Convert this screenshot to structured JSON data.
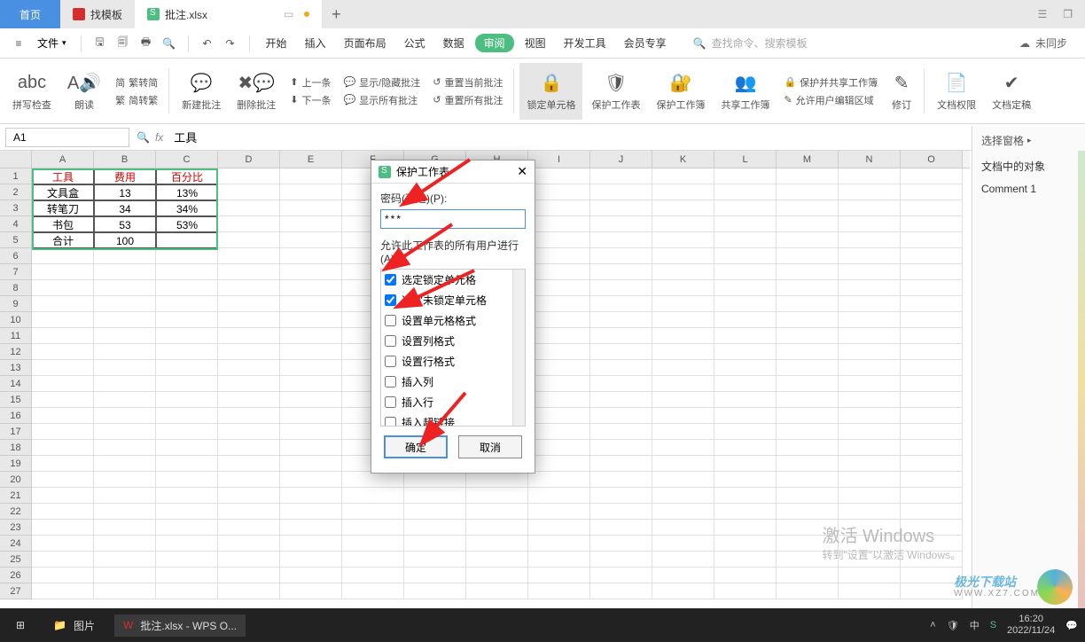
{
  "tabs": {
    "home": "首页",
    "template": "找模板",
    "file": "批注.xlsx",
    "add": "+"
  },
  "menubar": {
    "file": "文件",
    "items": [
      "开始",
      "插入",
      "页面布局",
      "公式",
      "数据",
      "审阅",
      "视图",
      "开发工具",
      "会员专享"
    ],
    "search_placeholder": "查找命令、搜索模板",
    "sync": "未同步"
  },
  "ribbon": {
    "spellcheck": "拼写检查",
    "read": "朗读",
    "convert1": "繁转简",
    "convert2": "简转繁",
    "newcomment": "新建批注",
    "delcomment": "删除批注",
    "prev": "上一条",
    "next": "下一条",
    "showhide": "显示/隐藏批注",
    "showall": "显示所有批注",
    "resetcur": "重置当前批注",
    "resetall": "重置所有批注",
    "lockcell": "锁定单元格",
    "protectsheet": "保护工作表",
    "protectbook": "保护工作簿",
    "sharebook": "共享工作簿",
    "protectshare": "保护并共享工作簿",
    "alloweditarea": "允许用户编辑区域",
    "revise": "修订",
    "docperm": "文档权限",
    "docfinal": "文档定稿"
  },
  "formulabar": {
    "name": "A1",
    "fx": "fx",
    "value": "工具"
  },
  "columns": [
    "A",
    "B",
    "C",
    "D",
    "E",
    "F",
    "G",
    "H",
    "I",
    "J",
    "K",
    "L",
    "M",
    "N",
    "O"
  ],
  "table": {
    "hdr": [
      "工具",
      "费用",
      "百分比"
    ],
    "rows": [
      [
        "文具盒",
        "13",
        "13%"
      ],
      [
        "转笔刀",
        "34",
        "34%"
      ],
      [
        "书包",
        "53",
        "53%"
      ],
      [
        "合计",
        "100",
        ""
      ]
    ]
  },
  "rightpane": {
    "selectpane": "选择窗格",
    "objects": "文档中的对象",
    "comment1": "Comment 1"
  },
  "dialog": {
    "title": "保护工作表",
    "password_label": "密码(可选)(P):",
    "password_value": "***",
    "allow_label": "允许此工作表的所有用户进行(A):",
    "perms": [
      {
        "label": "选定锁定单元格",
        "checked": true
      },
      {
        "label": "选定未锁定单元格",
        "checked": true
      },
      {
        "label": "设置单元格格式",
        "checked": false
      },
      {
        "label": "设置列格式",
        "checked": false
      },
      {
        "label": "设置行格式",
        "checked": false
      },
      {
        "label": "插入列",
        "checked": false
      },
      {
        "label": "插入行",
        "checked": false
      },
      {
        "label": "插入超链接",
        "checked": false
      }
    ],
    "ok": "确定",
    "cancel": "取消"
  },
  "activate": {
    "t1": "激活 Windows",
    "t2": "转到\"设置\"以激活 Windows。"
  },
  "watermark": {
    "t1": "极光下载站",
    "t2": "WWW.XZ7.COM"
  },
  "taskbar": {
    "pictures": "图片",
    "wps": "批注.xlsx - WPS O...",
    "time": "16:20",
    "date": "2022/11/24"
  }
}
